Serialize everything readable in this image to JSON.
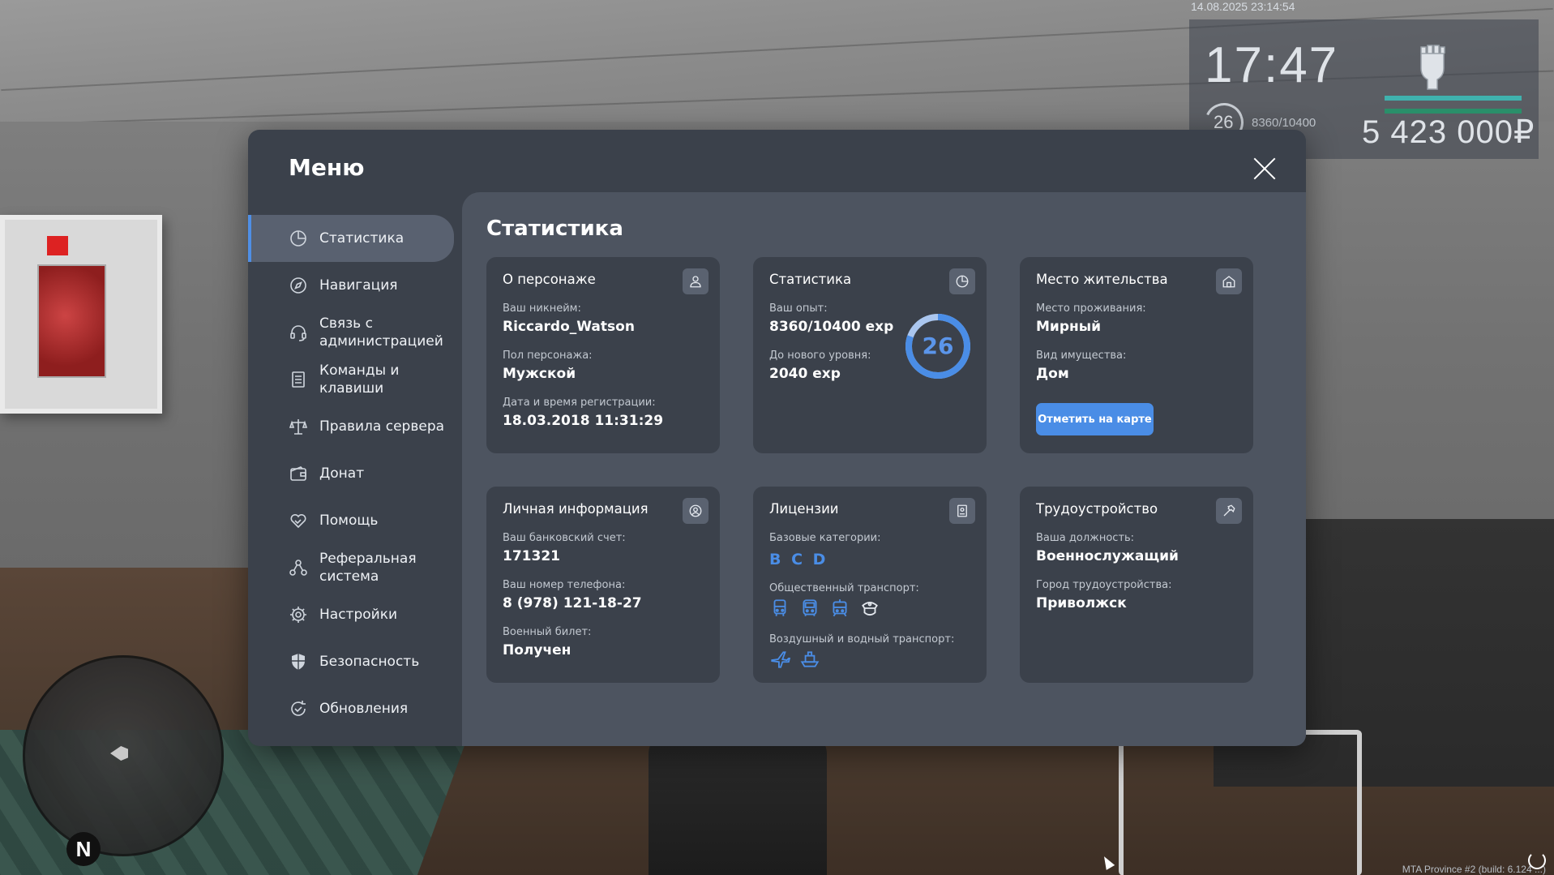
{
  "hud": {
    "datetime": "14.08.2025 23:14:54",
    "time": "17:47",
    "level": "26",
    "exp": "8360/10400",
    "money": "5 423 000₽",
    "bars": [
      {
        "name": "health",
        "fraction": 1.0,
        "color": "#3fb2ae"
      },
      {
        "name": "armor",
        "fraction": 1.0,
        "color": "#2a8f6a"
      }
    ]
  },
  "build_info": "MTA Province #2 (build: 6.124 ...)",
  "minimap": {
    "compass": "N"
  },
  "menu": {
    "title": "Меню",
    "sidebar": {
      "items": [
        {
          "label": "Статистика",
          "icon": "pie-chart-icon",
          "active": true
        },
        {
          "label": "Навигация",
          "icon": "compass-icon",
          "active": false
        },
        {
          "label": "Связь с администрацией",
          "icon": "headset-icon",
          "active": false
        },
        {
          "label": "Команды и клавиши",
          "icon": "document-list-icon",
          "active": false
        },
        {
          "label": "Правила сервера",
          "icon": "scales-icon",
          "active": false
        },
        {
          "label": "Донат",
          "icon": "wallet-icon",
          "active": false
        },
        {
          "label": "Помощь",
          "icon": "handshake-heart-icon",
          "active": false
        },
        {
          "label": "Реферальная система",
          "icon": "referral-network-icon",
          "active": false
        },
        {
          "label": "Настройки",
          "icon": "gear-icon",
          "active": false
        },
        {
          "label": "Безопасность",
          "icon": "shield-icon",
          "active": false
        },
        {
          "label": "Обновления",
          "icon": "refresh-check-icon",
          "active": false
        }
      ]
    },
    "content": {
      "title": "Статистика",
      "cards": {
        "character": {
          "title": "О персонаже",
          "icon": "user-icon",
          "nickname_label": "Ваш никнейм:",
          "nickname": "Riccardo_Watson",
          "gender_label": "Пол персонажа:",
          "gender": "Мужской",
          "reg_label": "Дата и время регистрации:",
          "reg": "18.03.2018 11:31:29"
        },
        "stats": {
          "title": "Статистика",
          "icon": "pie-chart-icon",
          "exp_label": "Ваш опыт:",
          "exp": "8360/10400 exp",
          "next_label": "До нового уровня:",
          "next": "2040 exp",
          "level": "26",
          "level_progress": 0.804
        },
        "residence": {
          "title": "Место жительства",
          "icon": "home-icon",
          "place_label": "Место проживания:",
          "place": "Мирный",
          "property_label": "Вид имущества:",
          "property": "Дом",
          "button": "Отметить на карте"
        },
        "personal": {
          "title": "Личная информация",
          "icon": "user-circle-icon",
          "bank_label": "Ваш банковский счет:",
          "bank": "171321",
          "phone_label": "Ваш номер телефона:",
          "phone": "8 (978) 121-18-27",
          "military_label": "Военный билет:",
          "military": "Получен"
        },
        "licenses": {
          "title": "Лицензии",
          "icon": "license-card-icon",
          "base_label": "Базовые категории:",
          "base": "B C D",
          "public_label": "Общественный транспорт:",
          "public_icons": [
            "bus-icon",
            "bus-front-icon",
            "tram-icon",
            "taxi-hat-icon"
          ],
          "air_label": "Воздушный и водный транспорт:",
          "air_icons": [
            "plane-icon",
            "ship-icon"
          ]
        },
        "job": {
          "title": "Трудоустройство",
          "icon": "hammer-icon",
          "position_label": "Ваша должность:",
          "position": "Военнослужащий",
          "city_label": "Город трудоустройства:",
          "city": "Приволжск"
        }
      }
    }
  },
  "colors": {
    "accent": "#4a8de6",
    "window_bg": "#3b414b",
    "content_bg": "#4d5460",
    "card_bg": "#3b414b"
  }
}
